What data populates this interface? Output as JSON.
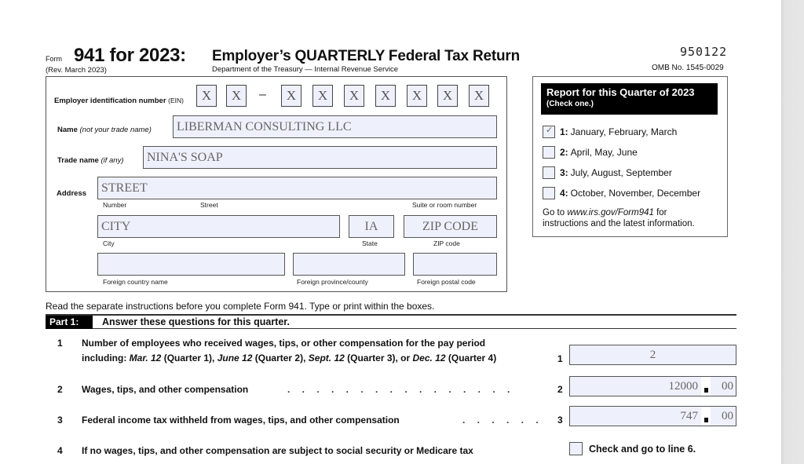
{
  "header": {
    "form_word": "Form",
    "form_number": "941 for 2023:",
    "form_title": "Employer’s QUARTERLY Federal Tax Return",
    "revision": "(Rev. March 2023)",
    "department": "Department of the Treasury — Internal Revenue Service",
    "form_code": "950122",
    "omb": "OMB No. 1545-0029"
  },
  "employer": {
    "ein_label": "Employer identification number",
    "ein_abbr": "(EIN)",
    "ein_digits": [
      "X",
      "X",
      "X",
      "X",
      "X",
      "X",
      "X",
      "X",
      "X"
    ],
    "ein_dash": "–",
    "name_label": "Name",
    "name_hint": "(not your trade name)",
    "name_value": "LIBERMAN CONSULTING LLC",
    "trade_label": "Trade name",
    "trade_hint": "(if any)",
    "trade_value": "NINA'S SOAP",
    "address_label": "Address",
    "street_value": "STREET",
    "street_sublabels": [
      "Number",
      "Street",
      "Suite or room number"
    ],
    "city_value": "CITY",
    "city_sublabel": "City",
    "state_value": "IA",
    "state_sublabel": "State",
    "zip_value": "ZIP CODE",
    "zip_sublabel": "ZIP code",
    "foreign_country_value": "",
    "foreign_country_sublabel": "Foreign country name",
    "foreign_province_value": "",
    "foreign_province_sublabel": "Foreign province/county",
    "foreign_postal_value": "",
    "foreign_postal_sublabel": "Foreign postal code"
  },
  "quarter": {
    "title": "Report for this Quarter of 2023",
    "subtitle": "(Check one.)",
    "options": [
      {
        "num": "1:",
        "label": "January, February, March",
        "checked": true
      },
      {
        "num": "2:",
        "label": "April, May, June",
        "checked": false
      },
      {
        "num": "3:",
        "label": "July, August, September",
        "checked": false
      },
      {
        "num": "4:",
        "label": "October, November, December",
        "checked": false
      }
    ],
    "check_mark": "✓",
    "note_prefix": "Go to ",
    "note_link": "www.irs.gov/Form941",
    "note_suffix": " for",
    "note_line2": "instructions and the latest information."
  },
  "instructions": "Read the separate instructions before you complete Form 941. Type or print within the boxes.",
  "part1": {
    "tag": "Part 1:",
    "title": "Answer these questions for this quarter.",
    "lines": [
      {
        "num": "1",
        "text_line1": "Number of employees who received wages, tips, or other compensation for the pay period",
        "text_line2_parts": [
          "including: ",
          "Mar. 12",
          " (Quarter 1), ",
          "June 12",
          " (Quarter 2), ",
          "Sept. 12",
          " (Quarter 3), or ",
          "Dec. 12",
          " (Quarter 4)"
        ],
        "box_num": "1",
        "value": "2"
      },
      {
        "num": "2",
        "text": "Wages, tips, and other compensation",
        "dots": ". . . . . . . . . . . . . . . .",
        "box_num": "2",
        "dollars": "12000",
        "cents": "00"
      },
      {
        "num": "3",
        "text": "Federal income tax withheld from wages, tips, and other compensation",
        "dots": ". . . . . .",
        "box_num": "3",
        "dollars": "747",
        "cents": "00"
      },
      {
        "num": "4",
        "text": "If no wages, tips, and other compensation are subject to social security or Medicare tax",
        "check_label": "Check and go to line 6."
      }
    ]
  }
}
